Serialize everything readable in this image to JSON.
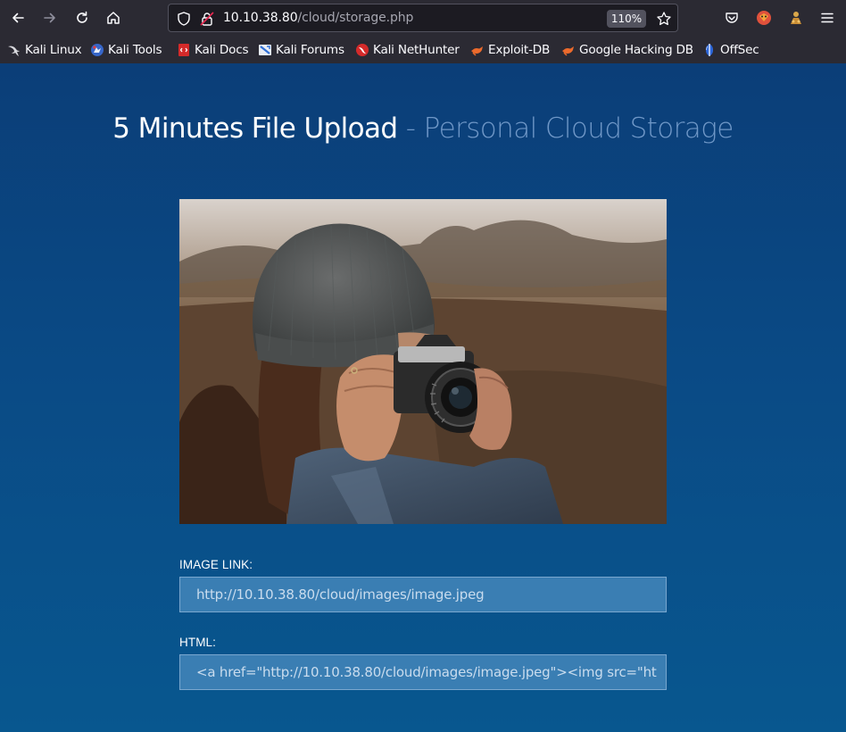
{
  "browser": {
    "url_host": "10.10.38.80",
    "url_path": "/cloud/storage.php",
    "zoom": "110%"
  },
  "bookmarks": [
    {
      "label": "Kali Linux",
      "icon": "kali-dragon-icon"
    },
    {
      "label": "Kali Tools",
      "icon": "kali-tools-icon"
    },
    {
      "label": "Kali Docs",
      "icon": "kali-docs-icon"
    },
    {
      "label": "Kali Forums",
      "icon": "kali-forums-icon"
    },
    {
      "label": "Kali NetHunter",
      "icon": "kali-nethunter-icon"
    },
    {
      "label": "Exploit-DB",
      "icon": "exploit-db-icon"
    },
    {
      "label": "Google Hacking DB",
      "icon": "ghdb-icon"
    },
    {
      "label": "OffSec",
      "icon": "offsec-icon"
    }
  ],
  "page": {
    "title_main": "5 Minutes File Upload",
    "title_sep": " - ",
    "title_sub": "Personal Cloud Storage",
    "image_link_label": "IMAGE LINK:",
    "image_link_value": "http://10.10.38.80/cloud/images/image.jpeg",
    "html_label": "HTML:",
    "html_value": "<a href=\"http://10.10.38.80/cloud/images/image.jpeg\"><img src=\"ht"
  },
  "colors": {
    "page_bg_top": "#0b3e78",
    "page_bg_bottom": "#08578f",
    "subtitle": "#6f97c7",
    "field_bg": "#3a7eb3"
  }
}
